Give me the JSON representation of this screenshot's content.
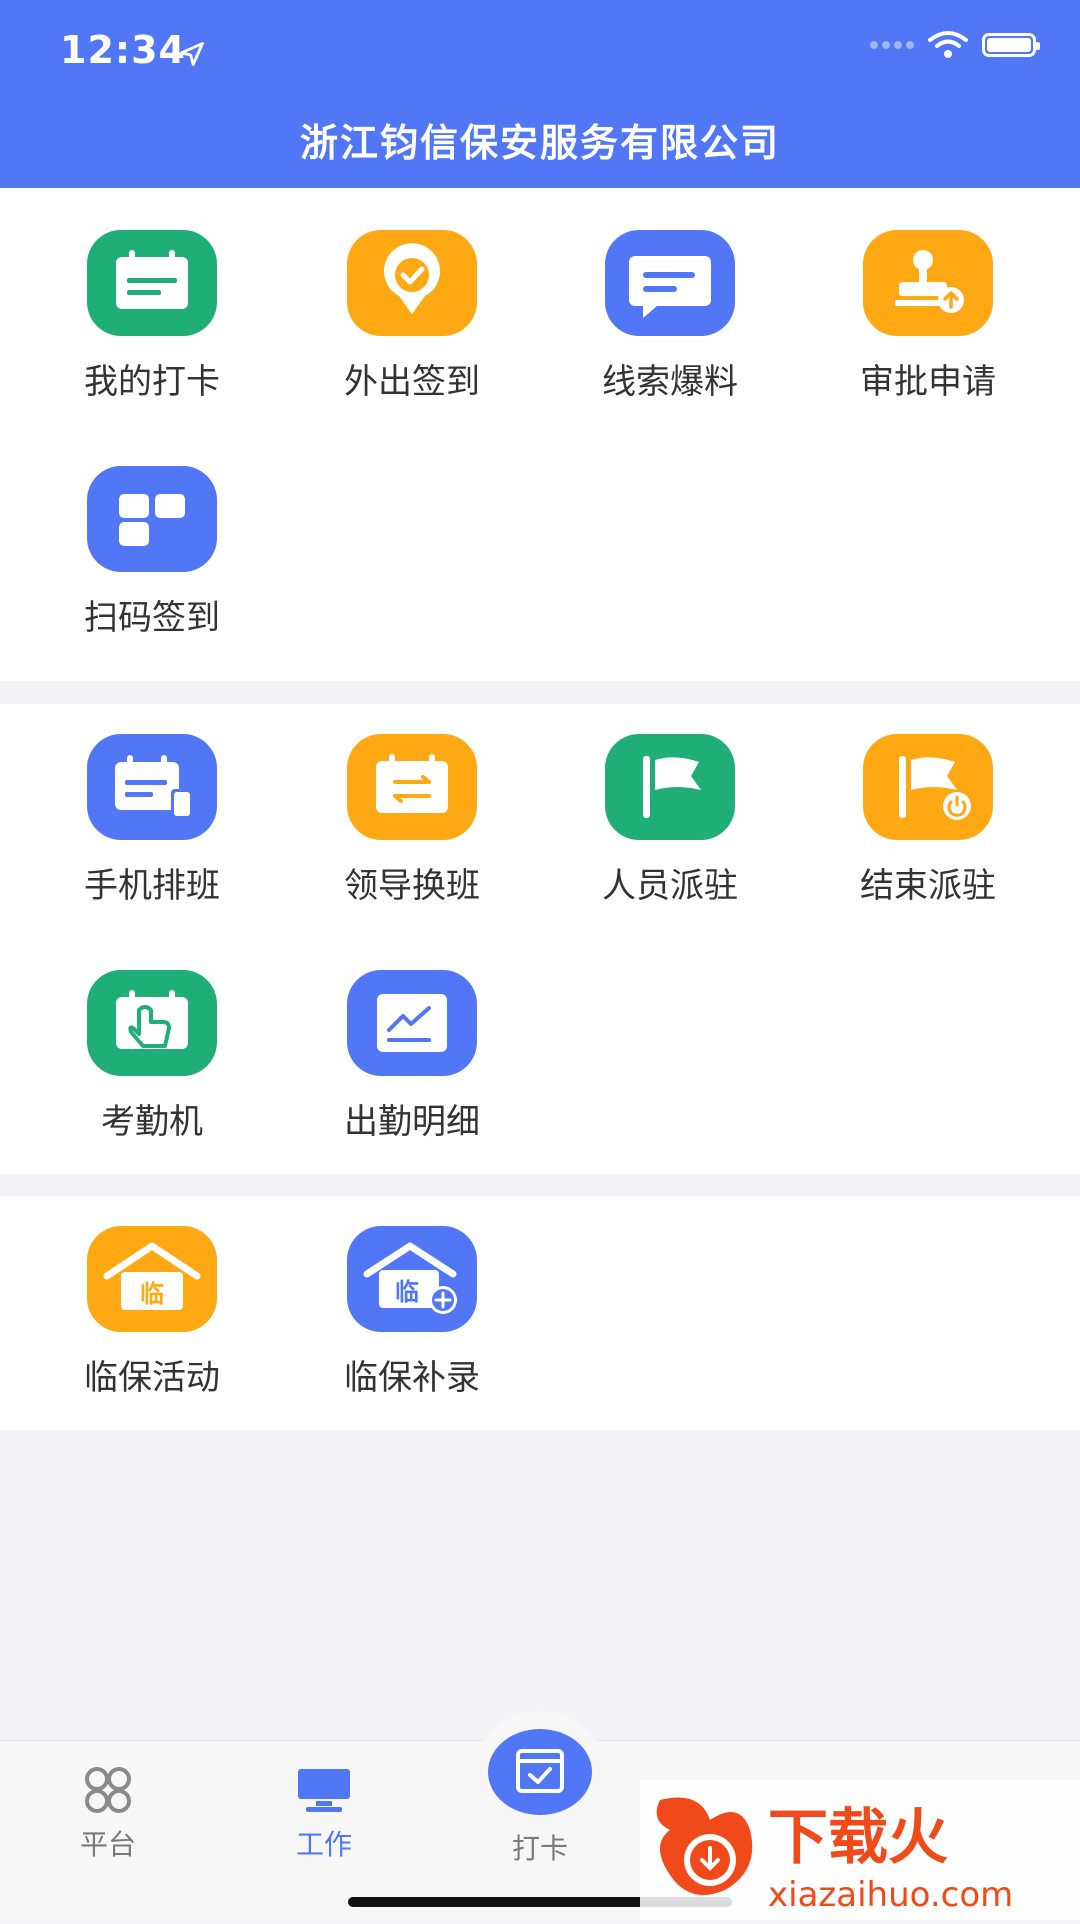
{
  "status_bar": {
    "time": "12:34"
  },
  "header": {
    "title": "浙江钧信保安服务有限公司"
  },
  "sections": [
    {
      "items": [
        {
          "label": "我的打卡",
          "icon": "calendar-card-icon",
          "color": "#1fae78"
        },
        {
          "label": "外出签到",
          "icon": "location-check-icon",
          "color": "#fea913"
        },
        {
          "label": "线索爆料",
          "icon": "chat-message-icon",
          "color": "#5177f6"
        },
        {
          "label": "审批申请",
          "icon": "stamp-upload-icon",
          "color": "#fea913"
        },
        {
          "label": "扫码签到",
          "icon": "qr-blocks-icon",
          "color": "#5177f6"
        }
      ]
    },
    {
      "items": [
        {
          "label": "手机排班",
          "icon": "calendar-phone-icon",
          "color": "#5177f6"
        },
        {
          "label": "领导换班",
          "icon": "swap-calendar-icon",
          "color": "#fea913"
        },
        {
          "label": "人员派驻",
          "icon": "flag-icon",
          "color": "#1fae78"
        },
        {
          "label": "结束派驻",
          "icon": "flag-power-icon",
          "color": "#fea913"
        },
        {
          "label": "考勤机",
          "icon": "hand-touch-icon",
          "color": "#1fae78"
        },
        {
          "label": "出勤明细",
          "icon": "trend-chart-icon",
          "color": "#5177f6"
        }
      ]
    },
    {
      "items": [
        {
          "label": "临保活动",
          "icon": "house-lin-icon",
          "color": "#fea913",
          "glyph": "临"
        },
        {
          "label": "临保补录",
          "icon": "house-lin-add-icon",
          "color": "#5177f6",
          "glyph": "临"
        }
      ]
    }
  ],
  "tabbar": {
    "tabs": [
      {
        "label": "平台",
        "icon": "grid-circles-icon"
      },
      {
        "label": "工作",
        "icon": "monitor-icon",
        "active": true
      },
      {
        "label": "打卡",
        "icon": "punch-card-icon"
      }
    ]
  },
  "watermark": {
    "text": "下载火",
    "url": "xiazaihuo.com"
  },
  "colors": {
    "primary": "#5177f6",
    "green": "#1fae78",
    "orange": "#fea913"
  }
}
